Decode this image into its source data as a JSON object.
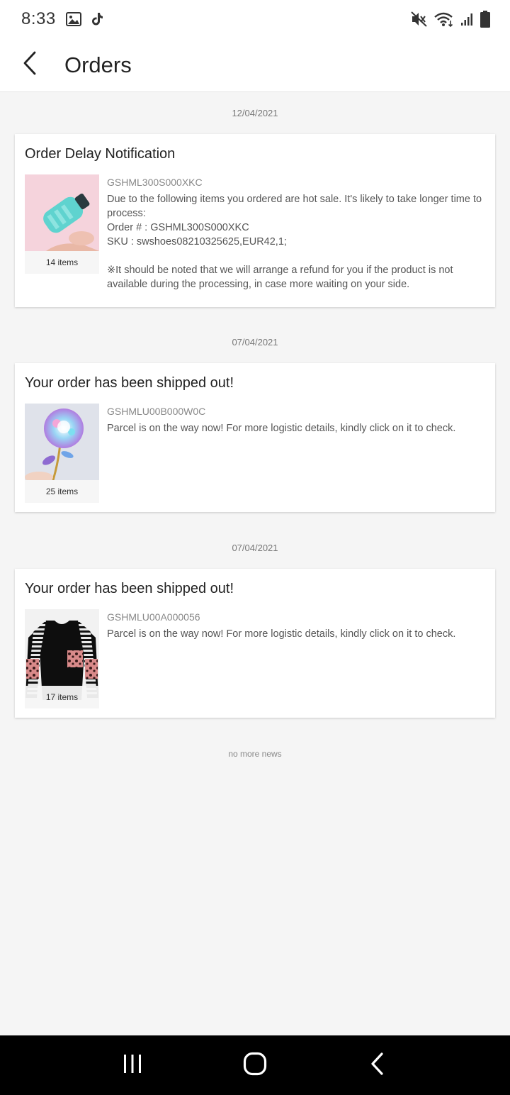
{
  "status_bar": {
    "time": "8:33",
    "left_icons": [
      "image-icon",
      "tiktok-icon"
    ],
    "right_icons": [
      "mute-icon",
      "wifi-icon",
      "signal-icon",
      "battery-icon"
    ]
  },
  "header": {
    "back_icon": "chevron-left-icon",
    "title": "Orders"
  },
  "messages": [
    {
      "date": "12/04/2021",
      "title": "Order Delay Notification",
      "order_id": "GSHML300S000XKC",
      "item_count": "14 items",
      "thumbnail": "teal-water-bottle",
      "description": "Due to the following items you ordered are hot sale. It's likely to take longer time to process:\nOrder # : GSHML300S000XKC\nSKU : swshoes08210325625,EUR42,1;\n\n※It should be noted that we will arrange a refund for you if the product is not available during the processing, in case more waiting on your side."
    },
    {
      "date": "07/04/2021",
      "title": "Your order has been shipped out!",
      "order_id": "GSHMLU00B000W0C",
      "item_count": "25 items",
      "thumbnail": "galaxy-rose",
      "description": "Parcel is on the way now! For more logistic details, kindly click on it to check."
    },
    {
      "date": "07/04/2021",
      "title": "Your order has been shipped out!",
      "order_id": "GSHMLU00A000056",
      "item_count": "17 items",
      "thumbnail": "striped-leopard-sweatshirt",
      "description": "Parcel is on the way now! For more logistic details, kindly click on it to check."
    }
  ],
  "footer_text": "no more news",
  "nav_bar": {
    "buttons": [
      "recents-icon",
      "home-icon",
      "back-icon"
    ]
  }
}
